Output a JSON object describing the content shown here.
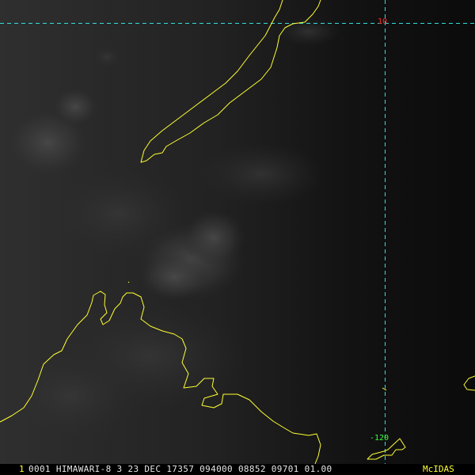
{
  "image": {
    "description_kind": "satellite visible imagery",
    "colors": {
      "coastline": "#ffff33",
      "gridline": "#33dddd",
      "lat_label": "#ff2a2a",
      "lon_label": "#3cff3c",
      "status_text": "#e6e6e6",
      "status_accent": "#ffff33"
    }
  },
  "grid": {
    "lat_label": "10",
    "lon_label": "-120"
  },
  "status_bar": {
    "frame_number": "1",
    "text": "0001 HIMAWARI-8   3 23 DEC 17357 094000 08852 09701 01.00",
    "brand": "McIDAS"
  }
}
